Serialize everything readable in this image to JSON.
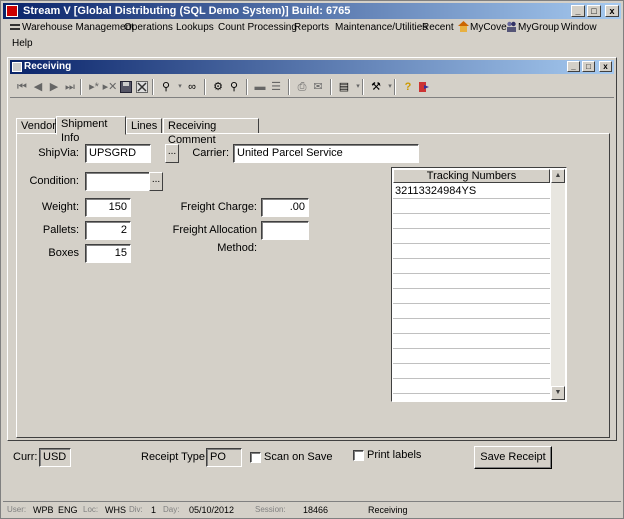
{
  "window": {
    "title": "Stream V [Global Distributing (SQL Demo System)] Build: 6765",
    "min": "_",
    "max": "□",
    "close": "x"
  },
  "menu": [
    {
      "label": "Warehouse Management"
    },
    {
      "label": "Operations"
    },
    {
      "label": "Lookups"
    },
    {
      "label": "Count Processing"
    },
    {
      "label": "Reports"
    },
    {
      "label": "Maintenance/Utilities"
    },
    {
      "label": "Recent"
    },
    {
      "label": "MyCove"
    },
    {
      "label": "MyGroup"
    },
    {
      "label": "Window"
    },
    {
      "label": "Help"
    }
  ],
  "child": {
    "title": "Receiving",
    "min": "_",
    "max": "□",
    "close": "x"
  },
  "toolbar": {
    "icons": [
      "first-icon",
      "prev-icon",
      "next-icon",
      "last-icon",
      "add-icon",
      "delete-icon",
      "save-icon",
      "cancel-icon",
      "filter-icon",
      "binoculars-icon",
      "zoom-icon",
      "search-icon",
      "form-icon",
      "list-icon",
      "print-icon",
      "email-icon",
      "export-icon",
      "tools-icon",
      "help-icon",
      "exit-icon"
    ]
  },
  "tabs": [
    {
      "label": "Vendor"
    },
    {
      "label": "Shipment Info"
    },
    {
      "label": "Lines"
    },
    {
      "label": "Receiving Comment"
    }
  ],
  "form": {
    "shipvia_label": "ShipVia:",
    "shipvia_value": "UPSGRD",
    "carrier_label": "Carrier:",
    "carrier_value": "United Parcel Service",
    "condition_label": "Condition:",
    "condition_value": "",
    "weight_label": "Weight:",
    "weight_value": "150",
    "pallets_label": "Pallets:",
    "pallets_value": "2",
    "boxes_label": "Boxes",
    "boxes_value": "15",
    "freight_charge_label": "Freight Charge:",
    "freight_charge_value": ".00",
    "freight_alloc_label": "Freight Allocation Method:",
    "freight_alloc_value": "",
    "ellipsis": "..."
  },
  "tracking": {
    "header": "Tracking Numbers",
    "rows": [
      "32113324984YS",
      "",
      "",
      "",
      "",
      "",
      "",
      "",
      "",
      "",
      "",
      "",
      "",
      ""
    ]
  },
  "bottom": {
    "curr_label": "Curr:",
    "curr_value": "USD",
    "receipt_type_label": "Receipt Type:",
    "receipt_type_value": "PO",
    "scan_on_save_label": "Scan on Save",
    "print_labels_label": "Print labels",
    "save_receipt": "Save Receipt"
  },
  "status": {
    "user_label": "User:",
    "user": "WPB",
    "lang": "ENG",
    "loc_label": "Loc:",
    "loc": "WHS",
    "div_label": "Div:",
    "div": "1",
    "day_label": "Day:",
    "day": "05/10/2012",
    "session_label": "Session:",
    "session": "18466",
    "screen": "Receiving"
  }
}
